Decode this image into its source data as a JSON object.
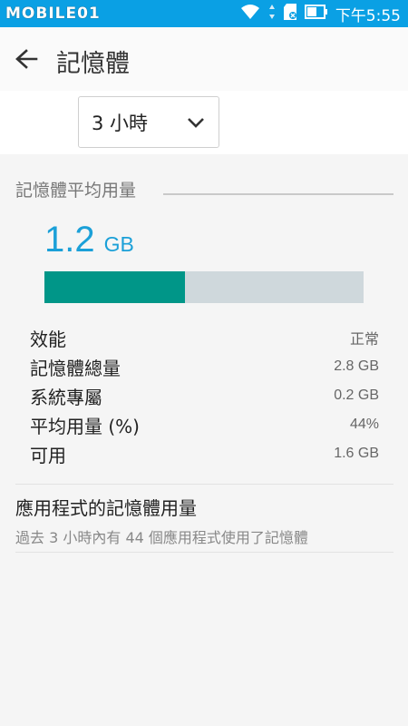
{
  "status_bar": {
    "logo": "MOBILE01",
    "time": "下午5:55",
    "icons": [
      "wifi-icon",
      "data-arrows-icon",
      "sd-card-icon",
      "battery-icon"
    ]
  },
  "app_bar": {
    "title": "記憶體",
    "back_icon": "arrow-left-icon"
  },
  "time_range": {
    "selected": "3 小時",
    "icon": "chevron-down-icon"
  },
  "section": {
    "title": "記憶體平均用量"
  },
  "summary": {
    "value": "1.2",
    "unit": "GB",
    "usage_fraction": 0.44
  },
  "stats": [
    {
      "label": "效能",
      "value": "正常"
    },
    {
      "label": "記憶體總量",
      "value": "2.8 GB"
    },
    {
      "label": "系統專屬",
      "value": "0.2 GB"
    },
    {
      "label": "平均用量 (%)",
      "value": "44%"
    },
    {
      "label": "可用",
      "value": "1.6 GB"
    }
  ],
  "app_usage": {
    "title": "應用程式的記憶體用量",
    "subtitle": "過去 3 小時內有 44 個應用程式使用了記憶體"
  },
  "colors": {
    "status_bar": "#0aa0e4",
    "accent": "#1ba0d8",
    "bar_fill": "#009688",
    "bar_track": "#cfd8dc"
  }
}
